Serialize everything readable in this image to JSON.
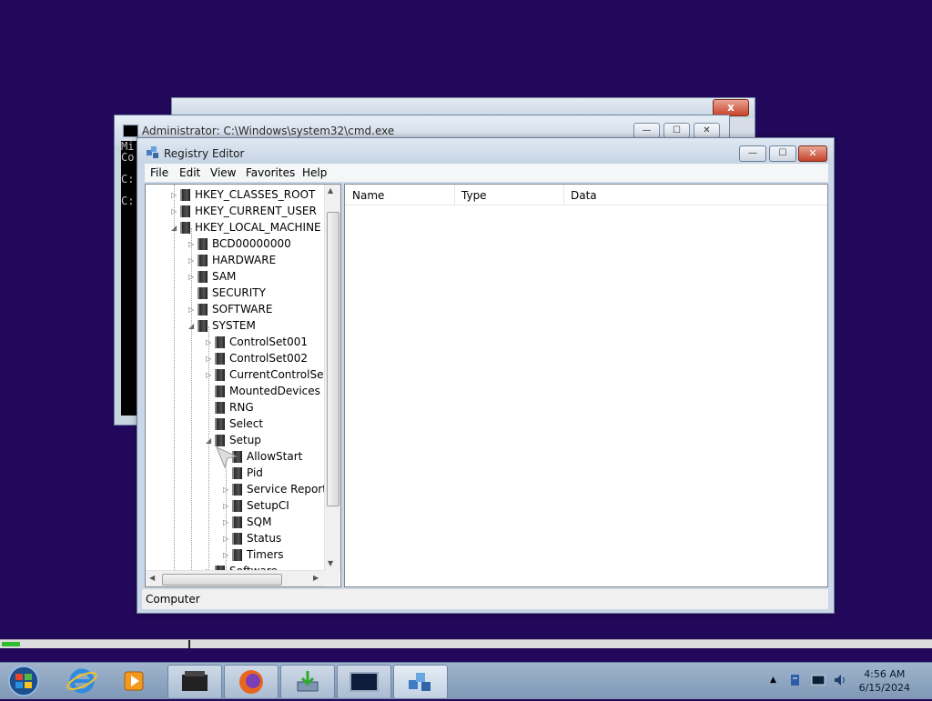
{
  "background_window": {
    "close_label": "x"
  },
  "cmd": {
    "title": "Administrator: C:\\Windows\\system32\\cmd.exe",
    "console_lines": [
      "Mi",
      "Co",
      "",
      "C:",
      "",
      "C:"
    ],
    "buttons": {
      "minimize": "—",
      "maximize": "☐",
      "close": "✕"
    }
  },
  "regedit": {
    "title": "Registry Editor",
    "buttons": {
      "minimize": "—",
      "maximize": "☐",
      "close": "✕"
    },
    "menu": [
      "File",
      "Edit",
      "View",
      "Favorites",
      "Help"
    ],
    "tree": [
      {
        "label": "HKEY_CLASSES_ROOT",
        "level": 1,
        "expander": "▷"
      },
      {
        "label": "HKEY_CURRENT_USER",
        "level": 1,
        "expander": "▷"
      },
      {
        "label": "HKEY_LOCAL_MACHINE",
        "level": 1,
        "expander": "◢"
      },
      {
        "label": "BCD00000000",
        "level": 2,
        "expander": "▷"
      },
      {
        "label": "HARDWARE",
        "level": 2,
        "expander": "▷"
      },
      {
        "label": "SAM",
        "level": 2,
        "expander": "▷"
      },
      {
        "label": "SECURITY",
        "level": 2,
        "expander": ""
      },
      {
        "label": "SOFTWARE",
        "level": 2,
        "expander": "▷"
      },
      {
        "label": "SYSTEM",
        "level": 2,
        "expander": "◢"
      },
      {
        "label": "ControlSet001",
        "level": 3,
        "expander": "▷"
      },
      {
        "label": "ControlSet002",
        "level": 3,
        "expander": "▷"
      },
      {
        "label": "CurrentControlSet",
        "level": 3,
        "expander": "▷"
      },
      {
        "label": "MountedDevices",
        "level": 3,
        "expander": ""
      },
      {
        "label": "RNG",
        "level": 3,
        "expander": ""
      },
      {
        "label": "Select",
        "level": 3,
        "expander": ""
      },
      {
        "label": "Setup",
        "level": 3,
        "expander": "◢"
      },
      {
        "label": "AllowStart",
        "level": 4,
        "expander": ""
      },
      {
        "label": "Pid",
        "level": 4,
        "expander": ""
      },
      {
        "label": "Service Report",
        "level": 4,
        "expander": "▷"
      },
      {
        "label": "SetupCI",
        "level": 4,
        "expander": "▷"
      },
      {
        "label": "SQM",
        "level": 4,
        "expander": "▷"
      },
      {
        "label": "Status",
        "level": 4,
        "expander": "▷"
      },
      {
        "label": "Timers",
        "level": 4,
        "expander": "▷"
      },
      {
        "label": "Software",
        "level": 3,
        "expander": "▷"
      }
    ],
    "columns": [
      "Name",
      "Type",
      "Data"
    ],
    "status_text": "Computer"
  },
  "progress_fraction": 0.02,
  "taskbar": {
    "items": [
      "start-orb",
      "internet-explorer",
      "media-player",
      "printer-app",
      "firefox",
      "download-app",
      "cmd-console",
      "registry-editor"
    ],
    "time": "4:56 AM",
    "date": "6/15/2024",
    "tray_expand": "▲"
  },
  "colors": {
    "desktop": "#22085a",
    "accent": "#2ebd2e"
  }
}
